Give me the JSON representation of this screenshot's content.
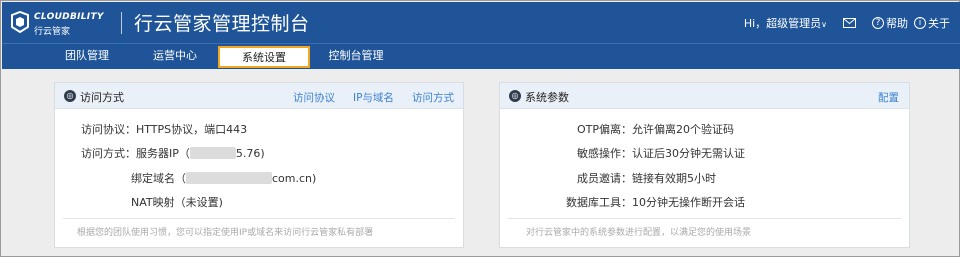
{
  "header": {
    "logo_en": "CLOUDBILITY",
    "logo_cn": "行云管家",
    "title": "行云管家管理控制台",
    "user_greeting": "Hi，超级管理员",
    "help": "帮助",
    "about": "关于"
  },
  "nav": {
    "items": [
      {
        "label": "团队管理"
      },
      {
        "label": "运营中心"
      },
      {
        "label": "系统设置"
      },
      {
        "label": "控制台管理"
      }
    ],
    "active_index": 2
  },
  "access_panel": {
    "title": "访问方式",
    "links": [
      "访问协议",
      "IP与域名",
      "访问方式"
    ],
    "rows": [
      {
        "label": "访问协议：",
        "value": "HTTPS协议，端口443"
      },
      {
        "label": "访问方式：",
        "value_prefix": "服务器IP（",
        "value_suffix": "5.76)"
      },
      {
        "label": "绑定域名（",
        "value_suffix": "com.cn)"
      },
      {
        "label": "NAT映射（未设置)"
      }
    ],
    "footer": "根据您的团队使用习惯，您可以指定使用IP或域名来访问行云管家私有部署"
  },
  "params_panel": {
    "title": "系统参数",
    "link": "配置",
    "rows": [
      {
        "label": "OTP偏离：",
        "value": "允许偏离20个验证码"
      },
      {
        "label": "敏感操作：",
        "value": "认证后30分钟无需认证"
      },
      {
        "label": "成员邀请：",
        "value": "链接有效期5小时"
      },
      {
        "label": "数据库工具：",
        "value": "10分钟无操作断开会话"
      }
    ],
    "footer": "对行云管家中的系统参数进行配置，以满足您的使用场景"
  },
  "colors": {
    "brand_blue": "#1f5598",
    "active_border": "#f0a81e",
    "link_blue": "#3b82d4"
  }
}
